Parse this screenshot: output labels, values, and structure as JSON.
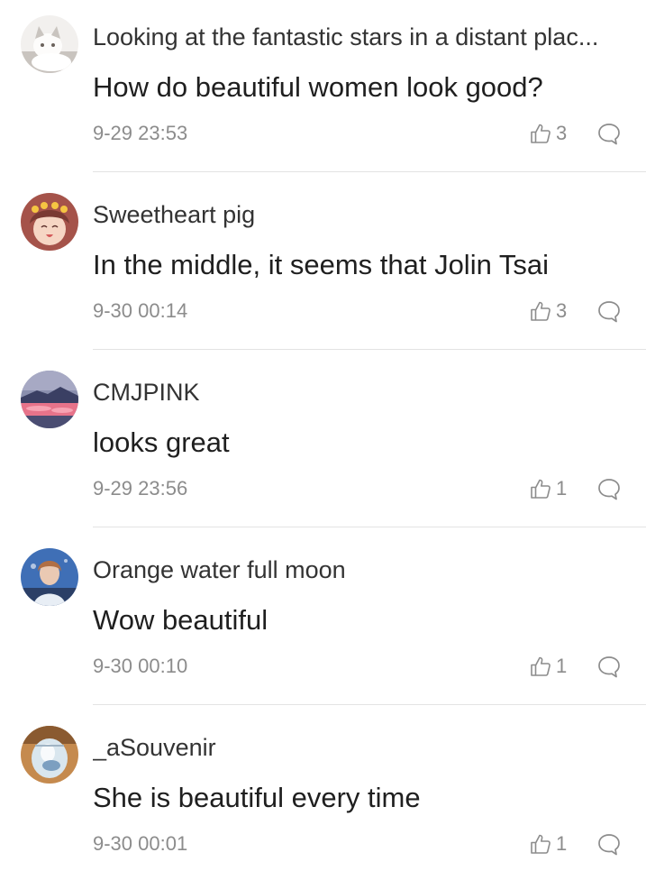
{
  "theme": {
    "text_primary": "#1f1f1f",
    "text_username": "#333333",
    "text_meta": "#8c8c8c",
    "divider": "#e3e3e3"
  },
  "comments": [
    {
      "username": "Looking at the fantastic stars in a distant plac...",
      "text": "How do beautiful women look good?",
      "time": "9-29 23:53",
      "likes": "3",
      "like_icon": "thumbs-up-outline",
      "reply_icon": "speech-bubble-outline",
      "avatar_colors": [
        "#f2f0ee",
        "#c9c4bf",
        "#6b625c"
      ]
    },
    {
      "username": "Sweetheart pig",
      "text": "In the middle, it seems that Jolin Tsai",
      "time": "9-30 00:14",
      "likes": "3",
      "like_icon": "thumbs-up-outline",
      "reply_icon": "speech-bubble-outline",
      "avatar_colors": [
        "#a5534a",
        "#f6d6c4",
        "#f5c542"
      ]
    },
    {
      "username": "CMJPINK",
      "text": "looks great",
      "time": "9-29 23:56",
      "likes": "1",
      "like_icon": "thumbs-up-outline",
      "reply_icon": "speech-bubble-outline",
      "avatar_colors": [
        "#8a8fae",
        "#e7738a",
        "#3a3f63"
      ]
    },
    {
      "username": "Orange water full moon",
      "text": "Wow beautiful",
      "time": "9-30 00:10",
      "likes": "1",
      "like_icon": "thumbs-up-outline",
      "reply_icon": "speech-bubble-outline",
      "avatar_colors": [
        "#3f6fb6",
        "#eac9b3",
        "#e8eef5"
      ]
    },
    {
      "username": "_aSouvenir",
      "text": "She is beautiful every time",
      "time": "9-30 00:01",
      "likes": "1",
      "like_icon": "thumbs-up-outline",
      "reply_icon": "speech-bubble-outline",
      "avatar_colors": [
        "#c58a4e",
        "#d9e6ee",
        "#7c9fc0"
      ]
    }
  ]
}
